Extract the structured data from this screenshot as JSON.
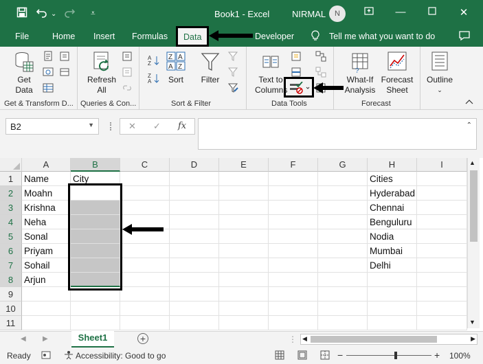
{
  "titlebar": {
    "title": "Book1 - Excel",
    "user": "NIRMAL",
    "avatar": "N"
  },
  "menu": {
    "tabs": [
      "File",
      "Home",
      "Insert",
      "Formulas",
      "Data",
      "Developer"
    ],
    "active": "Data",
    "tell_me": "Tell me what you want to do"
  },
  "ribbon": {
    "get_data": "Get\nData",
    "refresh_all": "Refresh\nAll",
    "sort": "Sort",
    "filter": "Filter",
    "text_to_columns": "Text to\nColumns",
    "what_if": "What-If\nAnalysis",
    "forecast_sheet": "Forecast\nSheet",
    "outline": "Outline",
    "groups": [
      "Get & Transform D...",
      "Queries & Con...",
      "Sort & Filter",
      "Data Tools",
      "Forecast"
    ]
  },
  "formula": {
    "namebox": "B2",
    "fx": "fx",
    "value": ""
  },
  "sheet": {
    "columns": [
      "A",
      "B",
      "C",
      "D",
      "E",
      "F",
      "G",
      "H",
      "I"
    ],
    "rows": [
      "1",
      "2",
      "3",
      "4",
      "5",
      "6",
      "7",
      "8",
      "9",
      "10",
      "11"
    ],
    "colA": [
      "Name",
      "Moahn",
      "Krishna",
      "Neha",
      "Sonal",
      "Priyam",
      "Sohail",
      "Arjun",
      "",
      "",
      ""
    ],
    "colB": [
      "City",
      "",
      "",
      "",
      "",
      "",
      "",
      "",
      "",
      "",
      ""
    ],
    "colH": [
      "Cities",
      "Hyderabad",
      "Chennai",
      "Benguluru",
      "Nodia",
      "Mumbai",
      "Delhi",
      "",
      "",
      "",
      ""
    ]
  },
  "sheettabs": {
    "active": "Sheet1",
    "add": "+"
  },
  "status": {
    "ready": "Ready",
    "accessibility": "Accessibility: Good to go",
    "zoom": "100%"
  },
  "colors": {
    "excel_green": "#1e7145",
    "selection": "#c6c6c6"
  }
}
